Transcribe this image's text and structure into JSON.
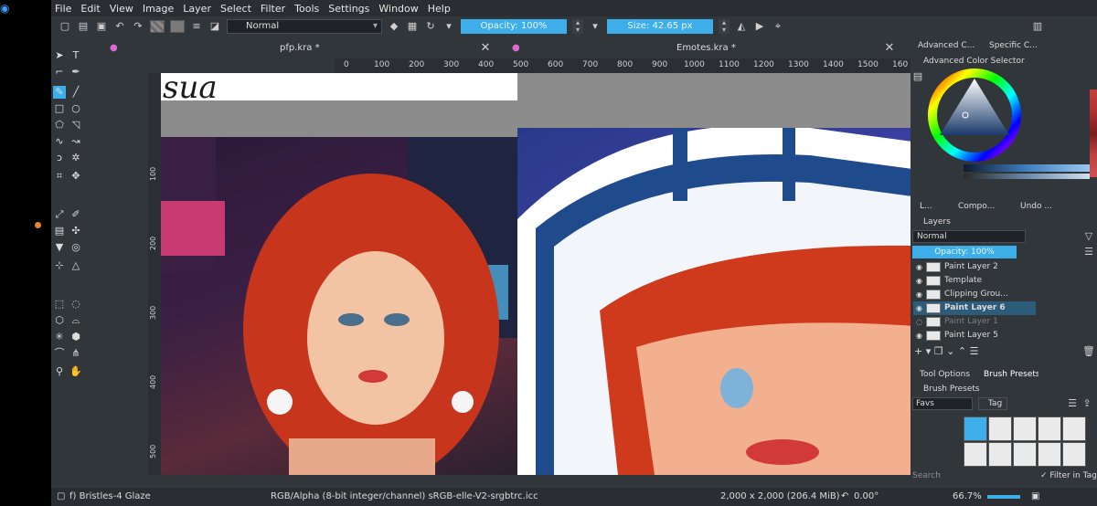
{
  "menu": [
    "File",
    "Edit",
    "View",
    "Image",
    "Layer",
    "Select",
    "Filter",
    "Tools",
    "Settings",
    "Window",
    "Help"
  ],
  "toolbar": {
    "blend_mode": "Normal",
    "opacity": "Opacity: 100%",
    "size": "Size: 42.65 px"
  },
  "documents": [
    {
      "name": "pfp.kra *"
    },
    {
      "name": "Emotes.kra *"
    }
  ],
  "ruler_h": [
    "0",
    "100",
    "200",
    "300",
    "400",
    "500",
    "600",
    "700",
    "800",
    "900",
    "1000",
    "1100",
    "1200",
    "1300",
    "1400",
    "1500",
    "160"
  ],
  "ruler_v": [
    "100",
    "200",
    "300",
    "400",
    "500"
  ],
  "canvas_text": "sua",
  "dockers": {
    "top_tabs": [
      "Advanced C...",
      "Specific C..."
    ],
    "color_selector_title": "Advanced Color Selector",
    "mid_tabs": [
      "L...",
      "Compo...",
      "Undo ..."
    ],
    "layers_title": "Layers",
    "layer_blend": "Normal",
    "layer_opacity": "Opacity: 100%",
    "layers": [
      {
        "name": "Paint Layer 2",
        "state": "normal"
      },
      {
        "name": "Template",
        "state": "normal"
      },
      {
        "name": "Clipping Grou...",
        "state": "normal"
      },
      {
        "name": "Paint Layer 6",
        "state": "active"
      },
      {
        "name": "Paint Layer 1",
        "state": "dim"
      },
      {
        "name": "Paint Layer 5",
        "state": "normal"
      }
    ],
    "bottom_tabs": [
      "Tool Options",
      "Brush Presets"
    ],
    "brush_presets_title": "Brush Presets",
    "brush_tag": "Favs",
    "tag_button": "Tag",
    "search_placeholder": "Search",
    "filter_in_tag": "Filter in Tag"
  },
  "status": {
    "brush": "f) Bristles-4 Glaze",
    "color_space": "RGB/Alpha (8-bit integer/channel)  sRGB-elle-V2-srgbtrc.icc",
    "image_size": "2,000 x 2,000 (206.4 MiB)",
    "rotation": "0.00°",
    "zoom": "66.7%"
  },
  "colors": {
    "accent": "#3daee9",
    "panel": "#31363b",
    "menubar": "#2a2e32"
  }
}
